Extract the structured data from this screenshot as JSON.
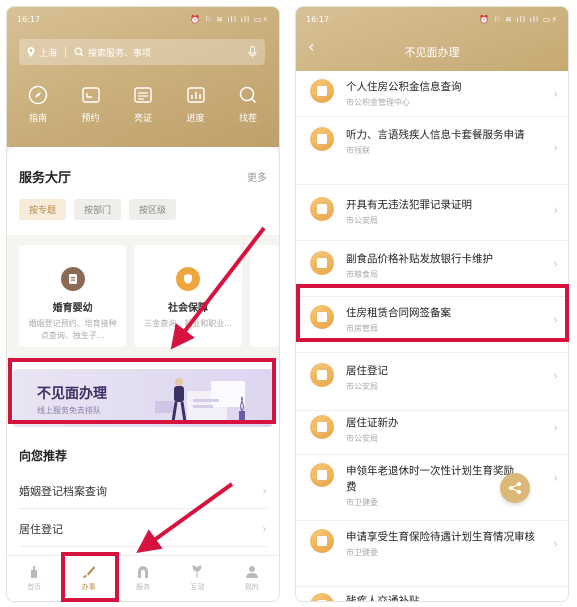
{
  "left": {
    "status": {
      "time": "16:17",
      "icons": "⏰ ⚐ ≋ ıll ıll ▭⚡"
    },
    "search": {
      "city": "上海",
      "placeholder": "搜索服务、事项"
    },
    "quick": [
      {
        "label": "指南",
        "icon": "compass-icon"
      },
      {
        "label": "预约",
        "icon": "calendar-icon"
      },
      {
        "label": "亮证",
        "icon": "id-card-icon"
      },
      {
        "label": "进度",
        "icon": "progress-icon"
      },
      {
        "label": "找茬",
        "icon": "search-icon"
      }
    ],
    "hall": {
      "title": "服务大厅",
      "more": "更多",
      "chips": [
        "按专题",
        "按部门",
        "按区级"
      ]
    },
    "cards": [
      {
        "title": "婚育婴幼",
        "desc": "婚姻登记预约、培育接种点查询、独生子...",
        "color": "#8a6a55"
      },
      {
        "title": "社会保障",
        "desc": "三金查询、就业和职业...",
        "color": "#f0a63f"
      }
    ],
    "banner": {
      "title": "不见面办理",
      "subtitle": "线上服务免去排队"
    },
    "recommend": {
      "title": "向您推荐",
      "items": [
        "婚姻登记档案查询",
        "居住登记"
      ]
    },
    "tabs": [
      {
        "label": "首页",
        "icon": "home-icon"
      },
      {
        "label": "办事",
        "icon": "brush-icon"
      },
      {
        "label": "服务",
        "icon": "arch-icon"
      },
      {
        "label": "互动",
        "icon": "plant-icon"
      },
      {
        "label": "我的",
        "icon": "person-icon"
      }
    ]
  },
  "right": {
    "status": {
      "time": "16:17",
      "icons": "⏰ ⚐ ≋ ıll ıll ▭⚡"
    },
    "nav_title": "不见面办理",
    "items": [
      {
        "title": "个人住房公积金信息查询",
        "sub": "市公积金管理中心"
      },
      {
        "title": "听力、言语残疾人信息卡套餐服务申请",
        "sub": "市残联"
      },
      {
        "title": "开具有无违法犯罪记录证明",
        "sub": "市公安局"
      },
      {
        "title": "副食品价格补贴发放银行卡维护",
        "sub": "市粮食局"
      },
      {
        "title": "住房租赁合同网签备案",
        "sub": "市房管局"
      },
      {
        "title": "居住登记",
        "sub": "市公安局"
      },
      {
        "title": "居住证新办",
        "sub": "市公安局"
      },
      {
        "title": "申领年老退休时一次性计划生育奖励费",
        "sub": "市卫健委"
      },
      {
        "title": "申请享受生育保险待遇计划生育情况审核",
        "sub": "市卫健委"
      },
      {
        "title": "残疾人交通补贴",
        "sub": ""
      }
    ]
  },
  "colors": {
    "gold": "#c9ad7a",
    "highlight": "#d6123f",
    "accent": "#b78c4c"
  }
}
